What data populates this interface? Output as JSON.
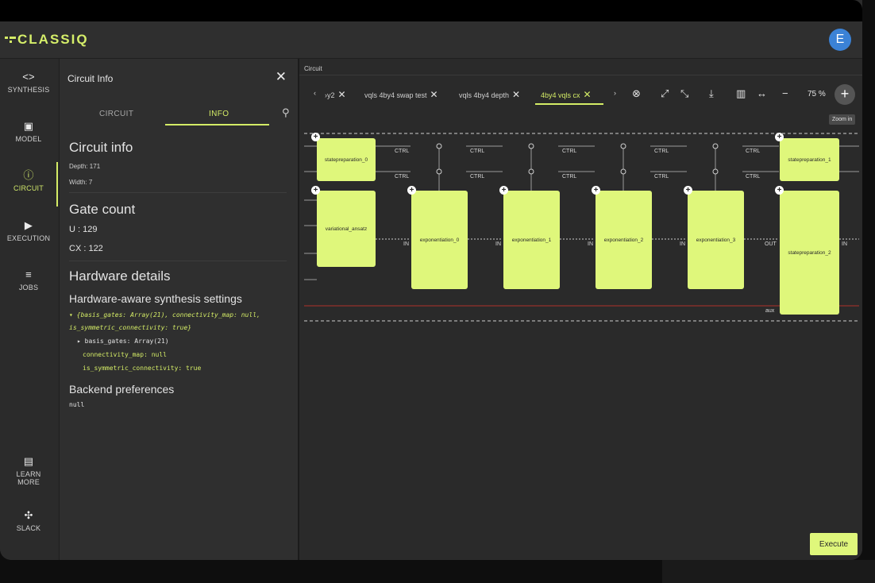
{
  "app": {
    "logo_text": "CLASSIQ",
    "avatar_letter": "E",
    "accent": "#d4ec66",
    "block_color": "#dff77b",
    "avatar_color": "#3b82d6"
  },
  "nav": {
    "synthesis": {
      "label": "SYNTHESIS",
      "icon": "code-icon"
    },
    "model": {
      "label": "MODEL",
      "icon": "model-icon"
    },
    "circuit": {
      "label": "CIRCUIT",
      "icon": "info-icon"
    },
    "execution": {
      "label": "EXECUTION",
      "icon": "play-icon"
    },
    "jobs": {
      "label": "JOBS",
      "icon": "list-icon"
    },
    "learn": {
      "label_line1": "LEARN",
      "label_line2": "MORE",
      "icon": "book-icon"
    },
    "slack": {
      "label": "SLACK",
      "icon": "slack-icon"
    }
  },
  "panel": {
    "title": "Circuit Info",
    "tabs": [
      "CIRCUIT",
      "INFO"
    ],
    "active_tab": "INFO",
    "circuit_info_heading": "Circuit info",
    "depth": "Depth: 171",
    "width": "Width: 7",
    "gate_count_heading": "Gate count",
    "gate_u": "U : 129",
    "gate_cx": "CX : 122",
    "hardware_heading": "Hardware details",
    "hw_settings_heading": "Hardware-aware synthesis settings",
    "json_line1": "▾ {basis_gates: Array(21), connectivity_map: null,",
    "json_line2": "is_symmetric_connectivity: true}",
    "json_line3": "▸ basis_gates: Array(21)",
    "json_line4": "connectivity_map: null",
    "json_line5": "is_symmetric_connectivity: true",
    "backend_heading": "Backend preferences",
    "backend_value": "null"
  },
  "workspace": {
    "label": "Circuit",
    "tabs": [
      "›y2",
      "vqls 4by4 swap test",
      "vqls 4by4 depth",
      "4by4 vqls cx"
    ],
    "active_tab": "4by4 vqls cx",
    "zoom": "75",
    "zoom_unit": "%",
    "tooltip": "Zoom in",
    "execute_label": "Execute"
  },
  "circuit": {
    "blocks": [
      "statepreparation_0",
      "variational_ansatz",
      "exponentiation_0",
      "exponentiation_1",
      "exponentiation_2",
      "exponentiation_3",
      "statepreparation_1",
      "statepreparation_2"
    ],
    "ctrl_label": "CTRL",
    "in_label": "IN",
    "out_label": "OUT",
    "aux_label": "aux"
  }
}
